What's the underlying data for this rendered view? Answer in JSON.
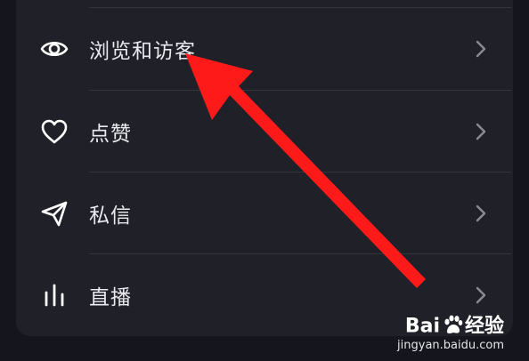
{
  "menu": {
    "items": [
      {
        "label": "浏览和访客",
        "icon": "eye-icon"
      },
      {
        "label": "点赞",
        "icon": "heart-icon"
      },
      {
        "label": "私信",
        "icon": "send-icon"
      },
      {
        "label": "直播",
        "icon": "bars-icon"
      }
    ]
  },
  "annotation": {
    "color": "#ff1a1a",
    "icon": "red-arrow"
  },
  "watermark": {
    "brand_pre": "Bai",
    "brand_post": "经验",
    "url": "jingyan.baidu.com"
  }
}
